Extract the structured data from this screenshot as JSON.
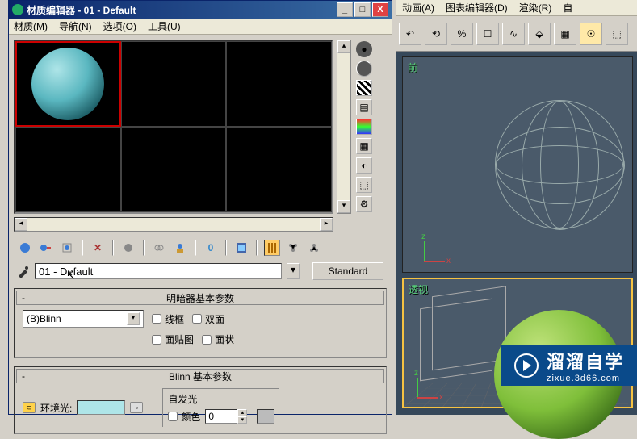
{
  "window": {
    "title": "材质编辑器 - 01 - Default",
    "minimize": "_",
    "maximize": "□",
    "close": "X"
  },
  "menu": {
    "material": "材质(M)",
    "navigate": "导航(N)",
    "options": "选项(O)",
    "tools": "工具(U)"
  },
  "material_name": "01 - Default",
  "standard_btn": "Standard",
  "rollout1": {
    "title": "明暗器基本参数",
    "shader": "(B)Blinn",
    "wire": "线框",
    "twoSided": "双面",
    "faceMap": "面贴图",
    "faceted": "面状"
  },
  "rollout2": {
    "title": "Blinn 基本参数",
    "ambient": "环境光:",
    "selfIllum": "自发光",
    "color": "颜色",
    "value": "0"
  },
  "right_menu": {
    "anim": "动画(A)",
    "graph": "图表编辑器(D)",
    "render": "渲染(R)",
    "custom": "自"
  },
  "viewport_front": "前",
  "viewport_persp": "透视",
  "axis_z": "z",
  "axis_x": "x",
  "watermark": {
    "text": "溜溜自学",
    "url": "zixue.3d66.com"
  },
  "side_icons": [
    "●",
    "●",
    "▦",
    "▲",
    "▤",
    "■",
    "◐",
    "▦",
    "⚙"
  ],
  "toolbar_icons": [
    "⬤",
    "℁",
    "☐",
    "✕",
    "●",
    "⬡",
    "⬡",
    "⬡",
    "⬡",
    "⬡",
    "⬛",
    "⬚",
    "⬚"
  ],
  "right_toolbar": [
    "↶",
    "⟲",
    "%",
    "☐",
    "⬚",
    "∿",
    "⬙",
    "⬚",
    "☉",
    "⬚"
  ]
}
